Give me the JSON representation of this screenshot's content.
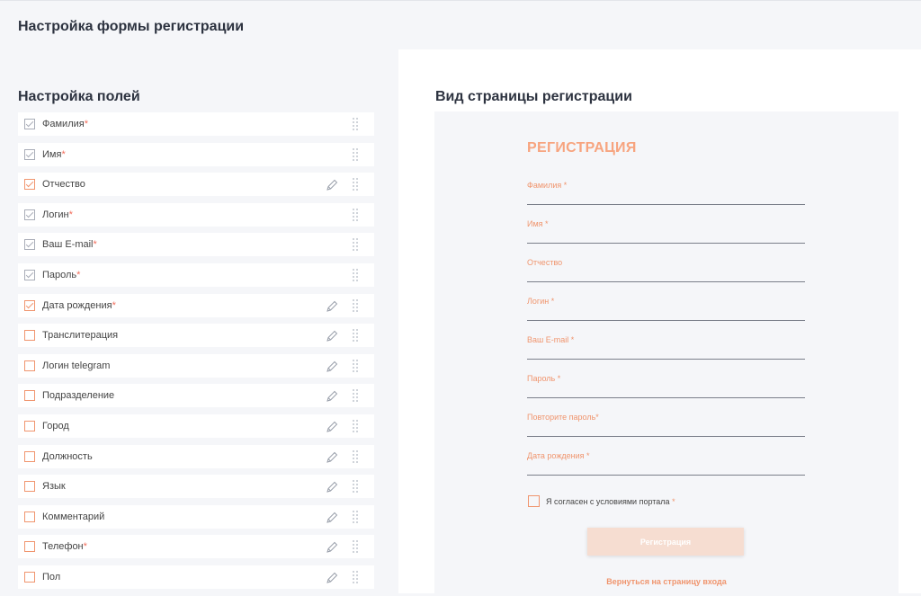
{
  "page_title": "Настройка формы регистрации",
  "fields_section": {
    "title": "Настройка полей",
    "items": [
      {
        "label": "Фамилия",
        "required": "*",
        "checked": true,
        "locked": true,
        "editable": false
      },
      {
        "label": "Имя",
        "required": "*",
        "checked": true,
        "locked": true,
        "editable": false
      },
      {
        "label": "Отчество",
        "required": "",
        "checked": true,
        "locked": false,
        "editable": true
      },
      {
        "label": "Логин",
        "required": "*",
        "checked": true,
        "locked": true,
        "editable": false
      },
      {
        "label": "Ваш E-mail",
        "required": "*",
        "checked": true,
        "locked": true,
        "editable": false
      },
      {
        "label": "Пароль",
        "required": "*",
        "checked": true,
        "locked": true,
        "editable": false
      },
      {
        "label": "Дата рождения",
        "required": "*",
        "checked": true,
        "locked": false,
        "editable": true
      },
      {
        "label": "Транслитерация",
        "required": "",
        "checked": false,
        "locked": false,
        "editable": true
      },
      {
        "label": "Логин telegram",
        "required": "",
        "checked": false,
        "locked": false,
        "editable": true
      },
      {
        "label": "Подразделение",
        "required": "",
        "checked": false,
        "locked": false,
        "editable": true
      },
      {
        "label": "Город",
        "required": "",
        "checked": false,
        "locked": false,
        "editable": true
      },
      {
        "label": "Должность",
        "required": "",
        "checked": false,
        "locked": false,
        "editable": true
      },
      {
        "label": "Язык",
        "required": "",
        "checked": false,
        "locked": false,
        "editable": true
      },
      {
        "label": "Комментарий",
        "required": "",
        "checked": false,
        "locked": false,
        "editable": true
      },
      {
        "label": "Телефон",
        "required": "*",
        "checked": false,
        "locked": false,
        "editable": true
      },
      {
        "label": "Пол",
        "required": "",
        "checked": false,
        "locked": false,
        "editable": true
      }
    ]
  },
  "preview_section": {
    "title": "Вид страницы регистрации",
    "form_title": "РЕГИСТРАЦИЯ",
    "fields": [
      "Фамилия *",
      "Имя *",
      "Отчество",
      "Логин *",
      "Ваш E-mail *",
      "Пароль *",
      "Повторите пароль*",
      "Дата рождения *"
    ],
    "agree_text": "Я согласен с условиями портала",
    "agree_required": "*",
    "submit_label": "Регистрация",
    "back_link": "Вернуться на страницу входа"
  },
  "colors": {
    "accent": "#f0956e",
    "required": "#f26d5b",
    "locked_checkbox": "#a9adb8",
    "background": "#f5f6f9"
  },
  "icons": [
    "check-icon",
    "pencil-icon",
    "drag-handle-icon"
  ]
}
